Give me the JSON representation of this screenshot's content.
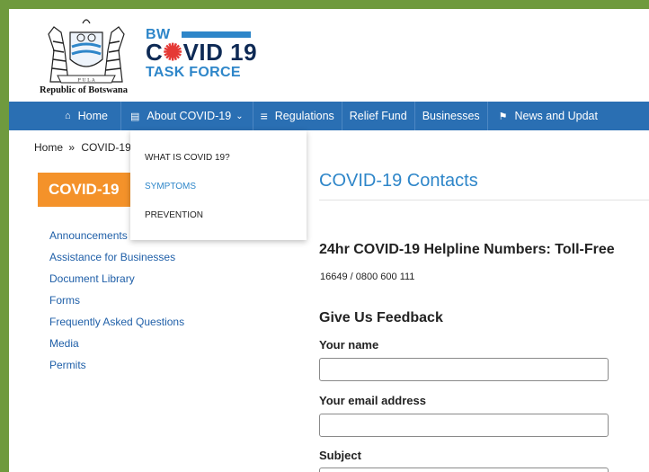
{
  "header": {
    "country_caption": "Republic of Botswana",
    "logo": {
      "line1": "BW",
      "line2_prefix": "C",
      "line2_virus": "✺",
      "line2_suffix": "VID 19",
      "line3": "TASK FORCE"
    }
  },
  "nav": {
    "items": [
      {
        "icon": "home-icon",
        "glyph": "⌂",
        "label": "Home"
      },
      {
        "icon": "newspaper-icon",
        "glyph": "▤",
        "label": "About COVID-19",
        "caret": "⌄"
      },
      {
        "icon": "menu-icon",
        "glyph": "≡",
        "label": "Regulations"
      },
      {
        "icon": "",
        "glyph": "",
        "label": "Relief Fund"
      },
      {
        "icon": "",
        "glyph": "",
        "label": "Businesses"
      },
      {
        "icon": "flag-icon",
        "glyph": "⚑",
        "label": "News and Updat"
      }
    ]
  },
  "breadcrumb": {
    "home": "Home",
    "sep": "»",
    "current": "COVID-19"
  },
  "dropdown": {
    "items": [
      "WHAT IS COVID 19?",
      "SYMPTOMS",
      "PREVENTION"
    ],
    "selected_index": 1
  },
  "sidebar": {
    "heading": "COVID-19",
    "links": [
      "Announcements",
      "Assistance for Businesses",
      "Document Library",
      "Forms",
      "Frequently Asked Questions",
      "Media",
      "Permits"
    ]
  },
  "main": {
    "title": "COVID-19 Contacts",
    "helpline_title": "24hr COVID-19 Helpline Numbers: Toll-Free",
    "helpline_numbers": "16649 / 0800 600 111",
    "feedback_title": "Give Us Feedback",
    "form": {
      "name_label": "Your name",
      "name_value": "",
      "email_label": "Your email address",
      "email_value": "",
      "subject_label": "Subject"
    }
  },
  "colors": {
    "frame": "#6f9a3e",
    "nav": "#2a6fb3",
    "accent_orange": "#f4922a",
    "link_blue": "#1f5fa8",
    "title_blue": "#2e86c9"
  }
}
